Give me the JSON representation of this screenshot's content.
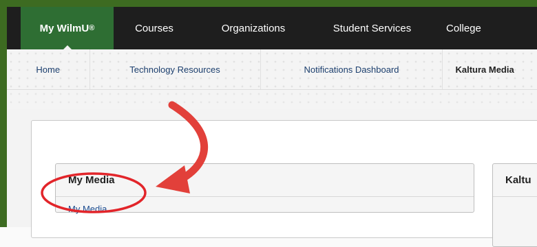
{
  "top_nav": {
    "items": [
      {
        "label": "My WilmU",
        "superscript": "®",
        "active": true
      },
      {
        "label": "Courses",
        "active": false
      },
      {
        "label": "Organizations",
        "active": false
      },
      {
        "label": "Student Services",
        "active": false
      },
      {
        "label": "College",
        "active": false
      }
    ]
  },
  "sub_nav": {
    "items": [
      {
        "label": "Home"
      },
      {
        "label": "Technology Resources"
      },
      {
        "label": "Notifications Dashboard"
      },
      {
        "label": "Kaltura Media",
        "current": true
      }
    ]
  },
  "widgets": {
    "my_media": {
      "title": "My Media",
      "link": "My Media"
    },
    "kaltura": {
      "title": "Kaltu"
    }
  },
  "colors": {
    "frame_green": "#3d6b21",
    "nav_active_green": "#2e6e33",
    "nav_background": "#1e1e1e",
    "link_blue": "#1d4b8f",
    "annotation_red": "#e2403a"
  },
  "annotations": {
    "arrow": "red-curved-arrow",
    "highlight": "red-ellipse"
  }
}
